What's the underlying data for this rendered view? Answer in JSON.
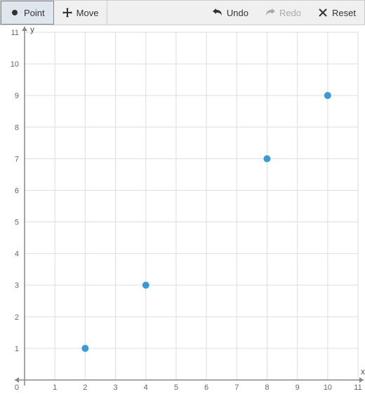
{
  "toolbar": {
    "point_label": "Point",
    "move_label": "Move",
    "undo_label": "Undo",
    "redo_label": "Redo",
    "reset_label": "Reset"
  },
  "chart_data": {
    "type": "scatter",
    "xlabel": "x",
    "ylabel": "y",
    "xlim": [
      0,
      11
    ],
    "ylim": [
      0,
      11
    ],
    "x_ticks": [
      0,
      1,
      2,
      3,
      4,
      5,
      6,
      7,
      8,
      9,
      10,
      11
    ],
    "y_ticks": [
      1,
      2,
      3,
      4,
      5,
      6,
      7,
      8,
      9,
      10,
      11
    ],
    "origin_label": "0",
    "points": [
      {
        "x": 2,
        "y": 1
      },
      {
        "x": 4,
        "y": 3
      },
      {
        "x": 8,
        "y": 7
      },
      {
        "x": 10,
        "y": 9
      }
    ],
    "point_color": "#3b9ad6"
  }
}
